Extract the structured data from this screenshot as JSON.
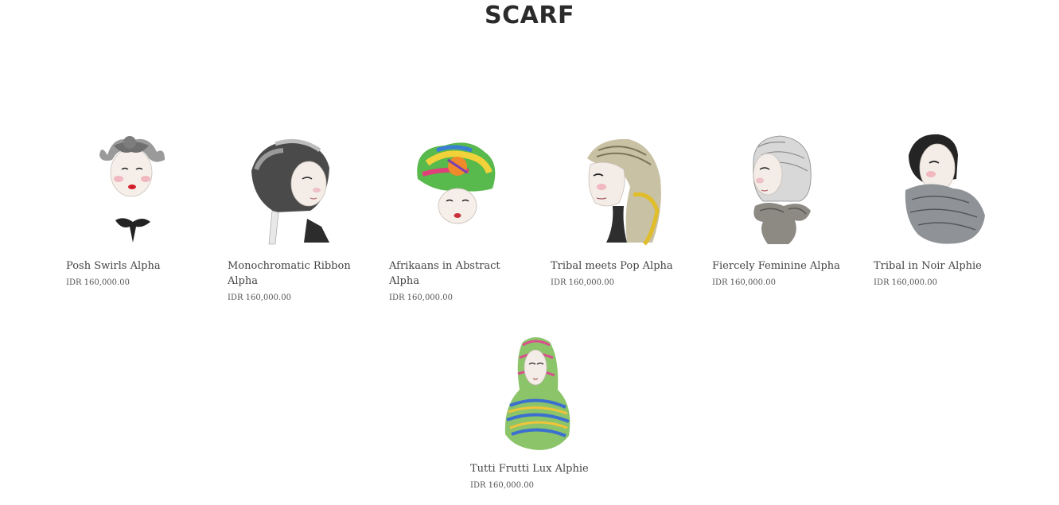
{
  "page": {
    "title": "SCARF"
  },
  "products": [
    {
      "name": "Posh Swirls Alpha",
      "price": "IDR 160,000.00"
    },
    {
      "name": "Monochromatic Ribbon Alpha",
      "price": "IDR 160,000.00"
    },
    {
      "name": "Afrikaans in Abstract Alpha",
      "price": "IDR 160,000.00"
    },
    {
      "name": "Tribal meets Pop Alpha",
      "price": "IDR 160,000.00"
    },
    {
      "name": "Fiercely Feminine Alpha",
      "price": "IDR 160,000.00"
    },
    {
      "name": "Tribal in Noir Alphie",
      "price": "IDR 160,000.00"
    },
    {
      "name": "Tutti Frutti Lux Alphie",
      "price": "IDR 160,000.00"
    }
  ]
}
